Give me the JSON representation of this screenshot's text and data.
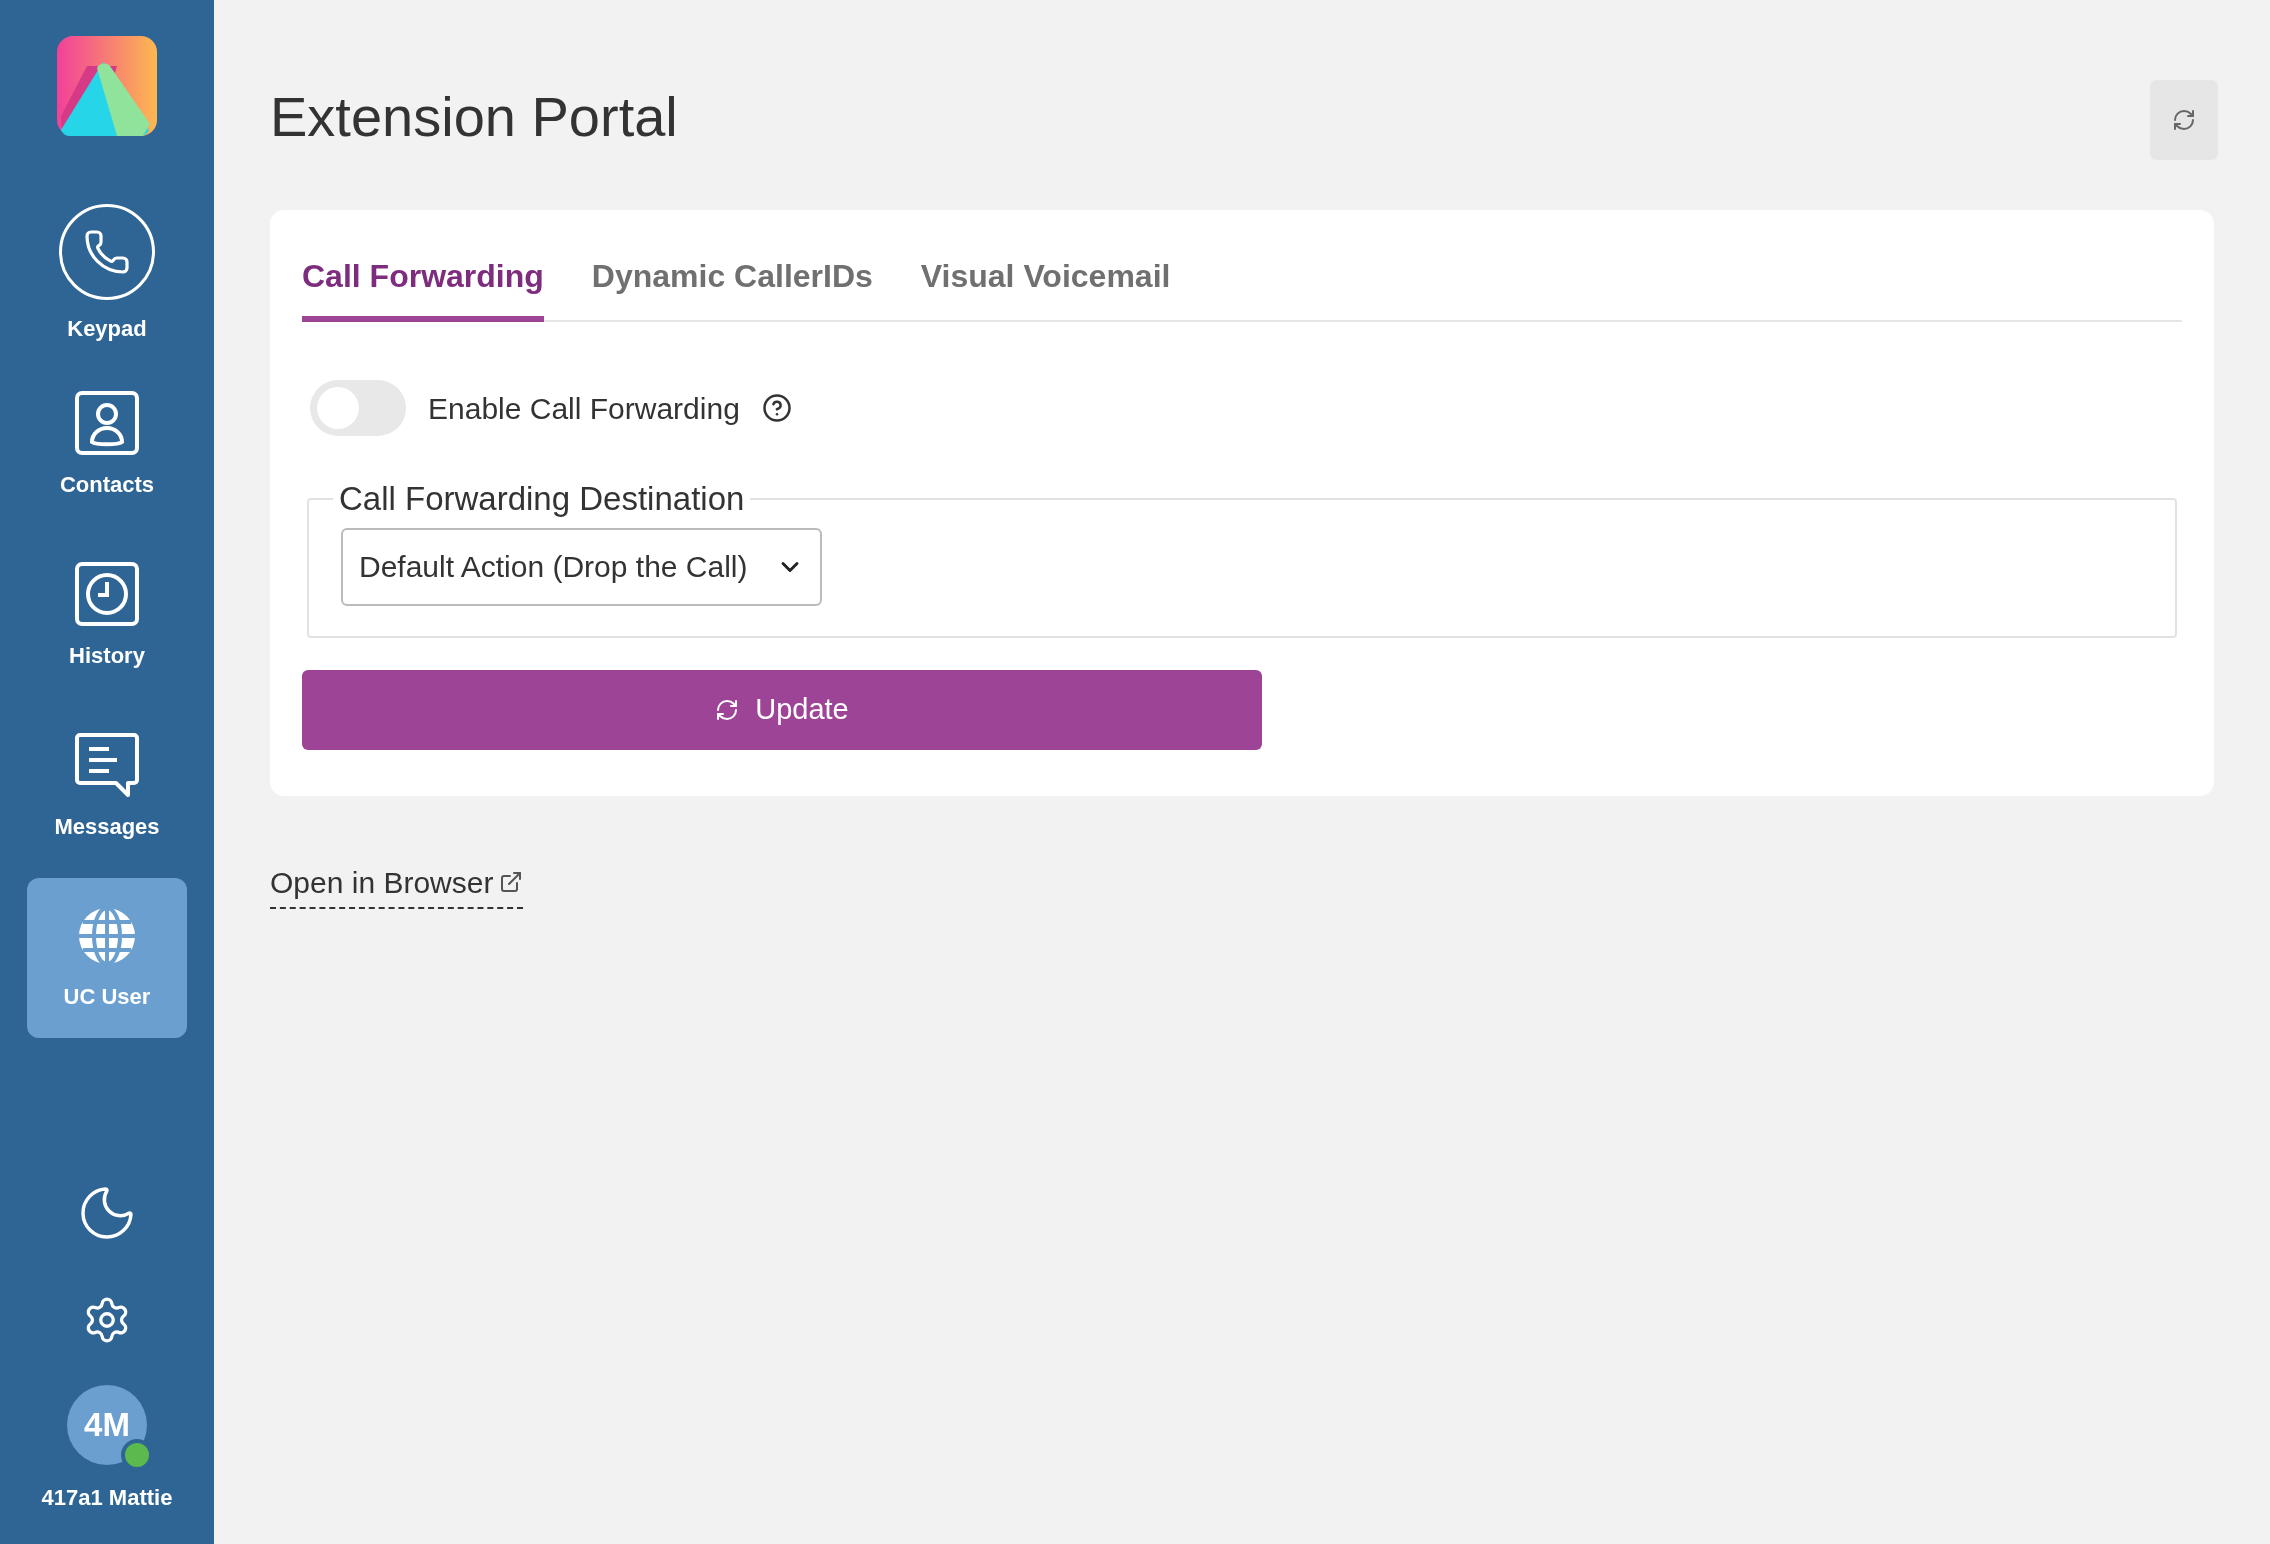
{
  "sidebar": {
    "nav": [
      {
        "kind": "phone",
        "label": "Keypad",
        "selected": false
      },
      {
        "kind": "contact",
        "label": "Contacts",
        "selected": false
      },
      {
        "kind": "clock",
        "label": "History",
        "selected": false
      },
      {
        "kind": "message",
        "label": "Messages",
        "selected": false
      },
      {
        "kind": "globe",
        "label": "UC User",
        "selected": true
      }
    ],
    "user": {
      "initials": "4M",
      "name": "417a1 Mattie",
      "color": "#5cb94d"
    }
  },
  "page": {
    "title": "Extension Portal"
  },
  "tabs": [
    {
      "label": "Call Forwarding",
      "selected": true
    },
    {
      "label": "Dynamic CallerIDs",
      "selected": false
    },
    {
      "label": "Visual Voicemail",
      "selected": false
    }
  ],
  "forwarding": {
    "toggle_label": "Enable Call Forwarding",
    "on": false,
    "destination_legend": "Call Forwarding Destination",
    "destination_value": "Default Action (Drop the Call)",
    "update_button": "Update"
  },
  "link": "Open in Browser"
}
